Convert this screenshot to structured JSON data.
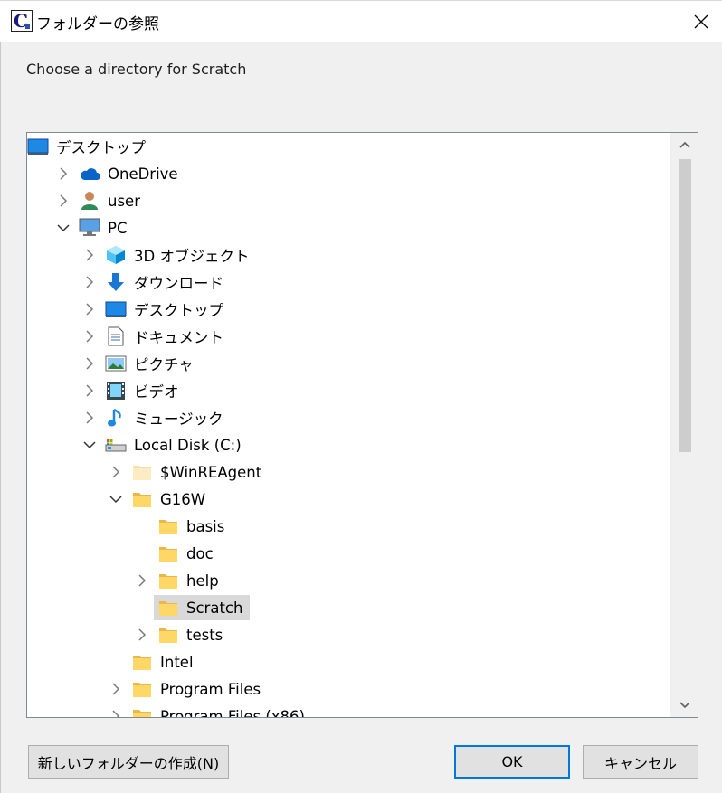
{
  "window": {
    "title": "フォルダーの参照",
    "app_icon_letter": "C"
  },
  "prompt": "Choose a directory for Scratch",
  "tree": [
    {
      "label": "デスクトップ",
      "icon": "desktop-icon",
      "expander": "none",
      "level": 0
    },
    {
      "label": "OneDrive",
      "icon": "cloud-icon",
      "expander": "collapsed",
      "level": 1
    },
    {
      "label": "user",
      "icon": "user-icon",
      "expander": "collapsed",
      "level": 1
    },
    {
      "label": "PC",
      "icon": "computer-icon",
      "expander": "expanded",
      "level": 1
    },
    {
      "label": "3D オブジェクト",
      "icon": "3d-objects-icon",
      "expander": "collapsed",
      "level": 2
    },
    {
      "label": "ダウンロード",
      "icon": "download-icon",
      "expander": "collapsed",
      "level": 2
    },
    {
      "label": "デスクトップ",
      "icon": "desktop-icon",
      "expander": "collapsed",
      "level": 2
    },
    {
      "label": "ドキュメント",
      "icon": "documents-icon",
      "expander": "collapsed",
      "level": 2
    },
    {
      "label": "ピクチャ",
      "icon": "pictures-icon",
      "expander": "collapsed",
      "level": 2
    },
    {
      "label": "ビデオ",
      "icon": "video-icon",
      "expander": "collapsed",
      "level": 2
    },
    {
      "label": "ミュージック",
      "icon": "music-icon",
      "expander": "collapsed",
      "level": 2
    },
    {
      "label": "Local Disk (C:)",
      "icon": "drive-icon",
      "expander": "expanded",
      "level": 2
    },
    {
      "label": "$WinREAgent",
      "icon": "folder-hidden-icon",
      "expander": "collapsed",
      "level": 3
    },
    {
      "label": "G16W",
      "icon": "folder-icon",
      "expander": "expanded",
      "level": 3
    },
    {
      "label": "basis",
      "icon": "folder-icon",
      "expander": "none",
      "level": 4
    },
    {
      "label": "doc",
      "icon": "folder-icon",
      "expander": "none",
      "level": 4
    },
    {
      "label": "help",
      "icon": "folder-icon",
      "expander": "collapsed",
      "level": 4
    },
    {
      "label": "Scratch",
      "icon": "folder-icon",
      "expander": "none",
      "level": 4,
      "selected": true
    },
    {
      "label": "tests",
      "icon": "folder-icon",
      "expander": "collapsed",
      "level": 4
    },
    {
      "label": "Intel",
      "icon": "folder-icon",
      "expander": "none",
      "level": 3
    },
    {
      "label": "Program Files",
      "icon": "folder-icon",
      "expander": "collapsed",
      "level": 3
    },
    {
      "label": "Program Files (x86)",
      "icon": "folder-icon",
      "expander": "collapsed",
      "level": 3
    }
  ],
  "buttons": {
    "new_folder": "新しいフォルダーの作成(N)",
    "ok": "OK",
    "cancel": "キャンセル"
  },
  "colors": {
    "selection": "#d9d9d9",
    "default_button_border": "#0078d7",
    "folder": "#ffd767",
    "folder_hidden": "#fbecc4"
  }
}
